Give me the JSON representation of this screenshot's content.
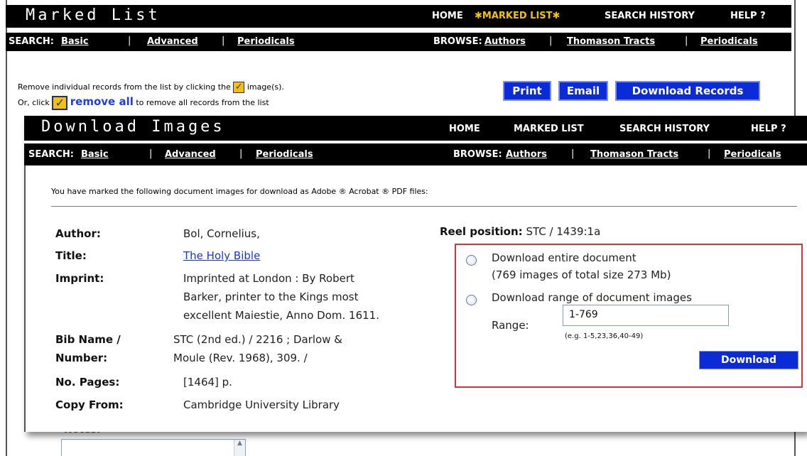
{
  "back_window": {
    "title": "Marked List",
    "top_nav": {
      "home": "HOME",
      "marked_list": "MARKED LIST",
      "search_history": "SEARCH HISTORY",
      "help": "HELP ?"
    },
    "search_bar": {
      "search_label": "SEARCH:",
      "basic": "Basic",
      "advanced": "Advanced",
      "periodicals": "Periodicals",
      "browse_label": "BROWSE:",
      "authors": "Authors",
      "thomason": "Thomason Tracts",
      "browse_periodicals": "Periodicals",
      "separator": "|"
    },
    "instructions": {
      "line1_before": "Remove individual records from the list by clicking the",
      "line1_after": "image(s).",
      "line2_before": "Or, click",
      "remove_all": "remove all",
      "line2_after": "to remove all records from the list"
    },
    "buttons": {
      "print": "Print",
      "email": "Email",
      "download_records": "Download Records"
    },
    "notes_label": "Notes:"
  },
  "front_window": {
    "title": "Download Images",
    "top_nav": {
      "home": "HOME",
      "marked_list": "MARKED LIST",
      "search_history": "SEARCH HISTORY",
      "help": "HELP ?"
    },
    "search_bar": {
      "search_label": "SEARCH:",
      "basic": "Basic",
      "advanced": "Advanced",
      "periodicals": "Periodicals",
      "browse_label": "BROWSE:",
      "authors": "Authors",
      "thomason": "Thomason Tracts",
      "browse_periodicals": "Periodicals",
      "separator": "|"
    },
    "intro": "You have marked the following document images for download as Adobe ® Acrobat ® PDF files:",
    "record": {
      "author_label": "Author:",
      "author": "Bol, Cornelius,",
      "title_label": "Title:",
      "title": "The Holy Bible",
      "imprint_label": "Imprint:",
      "imprint_lines": [
        "Imprinted at London : By Robert",
        "Barker, printer to the Kings most",
        "excellent Maiestie, Anno Dom. 1611."
      ],
      "bib_label_lines": [
        "Bib Name /",
        "Number:"
      ],
      "bib_lines": [
        "STC (2nd ed.) / 2216 ; Darlow &",
        "Moule (Rev. 1968), 309. /"
      ],
      "pages_label": "No. Pages:",
      "pages": "[1464] p.",
      "copy_label": "Copy From:",
      "copy": "Cambridge University Library"
    },
    "reel": {
      "label": "Reel position:",
      "value": "STC / 1439:1a"
    },
    "download": {
      "option_entire": "Download entire document",
      "option_entire_detail": "(769 images of total size 273 Mb)",
      "option_range": "Download range of document images",
      "range_label": "Range:",
      "range_value": "1-769",
      "hint": "(e.g. 1-5,23,36,40-49)",
      "button": "Download"
    }
  },
  "colors": {
    "accent_blue": "#0b2bd6",
    "highlight_gold": "#f4c400",
    "box_red": "#d8323a"
  }
}
